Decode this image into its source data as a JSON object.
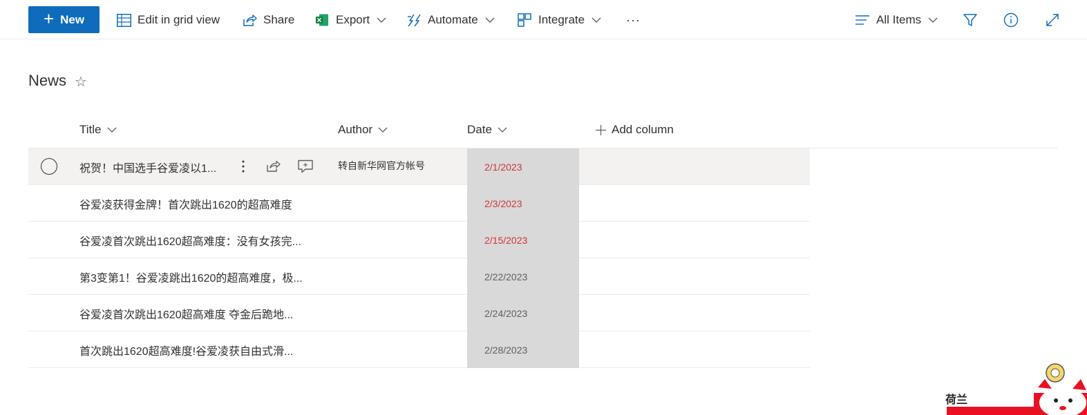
{
  "toolbar": {
    "new_label": "New",
    "edit_grid_label": "Edit in grid view",
    "share_label": "Share",
    "export_label": "Export",
    "automate_label": "Automate",
    "integrate_label": "Integrate",
    "more_label": "···",
    "view_label": "All Items"
  },
  "list": {
    "title": "News",
    "columns": {
      "title": "Title",
      "author": "Author",
      "date": "Date",
      "add_column": "Add column"
    },
    "rows": [
      {
        "title": "祝贺！中国选手谷爱凌以1...",
        "author": "转自新华网官方帐号",
        "date": "2/1/2023",
        "date_color": "#d13438"
      },
      {
        "title": "谷爱凌获得金牌！首次跳出1620的超高难度",
        "author": "",
        "date": "2/3/2023",
        "date_color": "#d13438"
      },
      {
        "title": "谷爱凌首次跳出1620超高难度：没有女孩完...",
        "author": "",
        "date": "2/15/2023",
        "date_color": "#d13438"
      },
      {
        "title": "第3变第1！谷爱凌跳出1620的超高难度，极...",
        "author": "",
        "date": "2/22/2023",
        "date_color": "#605e5c"
      },
      {
        "title": "谷爱凌首次跳出1620超高难度 夺金后跪地...",
        "author": "",
        "date": "2/24/2023",
        "date_color": "#605e5c"
      },
      {
        "title": "首次跳出1620超高难度!谷爱凌获自由式滑...",
        "author": "",
        "date": "2/28/2023",
        "date_color": "#605e5c"
      }
    ]
  },
  "overlay": {
    "label": "荷兰"
  },
  "colors": {
    "brand": "#0f6cbd",
    "excel": "#107c41",
    "accent_icon": "#0f6cbd",
    "date_cell_bg": "#d9d9d9"
  }
}
